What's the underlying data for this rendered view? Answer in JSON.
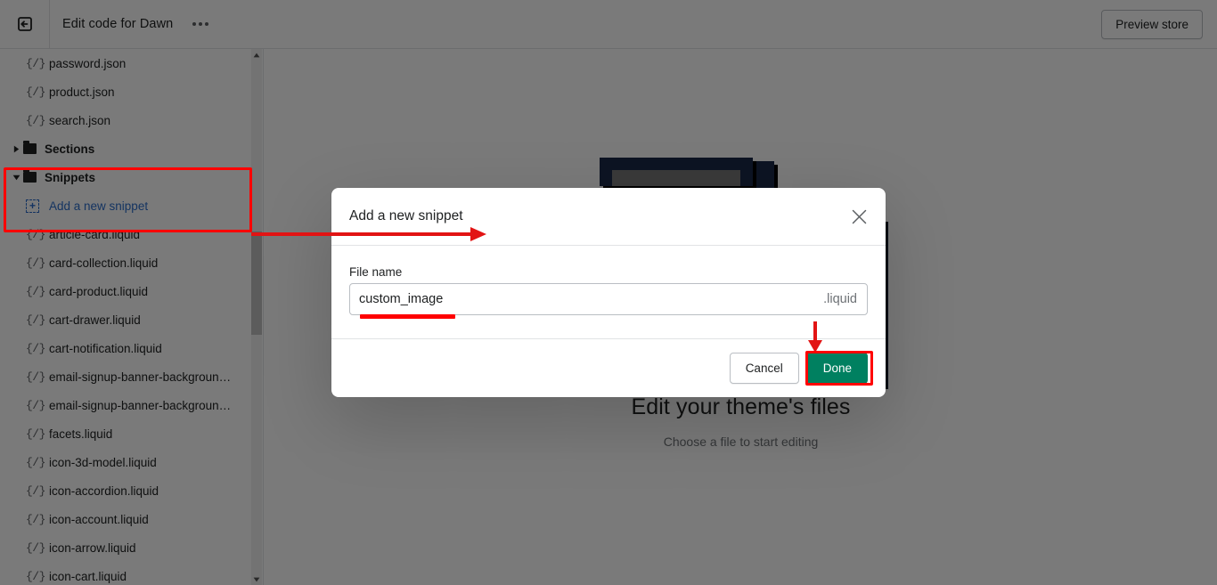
{
  "topbar": {
    "exit_icon": "exit-left-icon",
    "title": "Edit code for Dawn",
    "more_icon": "ellipsis-icon",
    "preview_store_label": "Preview store"
  },
  "sidebar": {
    "code_icon_glyph": "{/}",
    "add_icon_glyph": "+",
    "items": [
      {
        "type": "file",
        "label": "password.json"
      },
      {
        "type": "file",
        "label": "product.json"
      },
      {
        "type": "file",
        "label": "search.json"
      },
      {
        "type": "folder",
        "label": "Sections",
        "expanded": false
      },
      {
        "type": "folder",
        "label": "Snippets",
        "expanded": true,
        "highlighted": true
      },
      {
        "type": "add",
        "label": "Add a new snippet",
        "highlighted": true
      },
      {
        "type": "file",
        "label": "article-card.liquid"
      },
      {
        "type": "file",
        "label": "card-collection.liquid"
      },
      {
        "type": "file",
        "label": "card-product.liquid"
      },
      {
        "type": "file",
        "label": "cart-drawer.liquid"
      },
      {
        "type": "file",
        "label": "cart-notification.liquid"
      },
      {
        "type": "file",
        "label": "email-signup-banner-backgroun…"
      },
      {
        "type": "file",
        "label": "email-signup-banner-backgroun…"
      },
      {
        "type": "file",
        "label": "facets.liquid"
      },
      {
        "type": "file",
        "label": "icon-3d-model.liquid"
      },
      {
        "type": "file",
        "label": "icon-accordion.liquid"
      },
      {
        "type": "file",
        "label": "icon-account.liquid"
      },
      {
        "type": "file",
        "label": "icon-arrow.liquid"
      },
      {
        "type": "file",
        "label": "icon-cart.liquid"
      }
    ],
    "scrollbar": {
      "up_icon": "caret-up-icon",
      "down_icon": "caret-down-icon"
    }
  },
  "main": {
    "empty_title": "Edit your theme's files",
    "empty_subtitle": "Choose a file to start editing"
  },
  "modal": {
    "title": "Add a new snippet",
    "close_icon": "close-icon",
    "field_label": "File name",
    "filename_value": "custom_image",
    "filename_placeholder": "",
    "filename_suffix": ".liquid",
    "cancel_label": "Cancel",
    "done_label": "Done"
  },
  "annotations": {
    "highlight_color": "#ff0000",
    "accent_green": "#008060",
    "link_blue": "#2c6ecb",
    "boxes": [
      "snippets-folder-row",
      "done-button",
      "filename-underline"
    ],
    "arrows": [
      "sidebar-to-modal-title-arrow",
      "down-arrow-to-done-button"
    ]
  }
}
